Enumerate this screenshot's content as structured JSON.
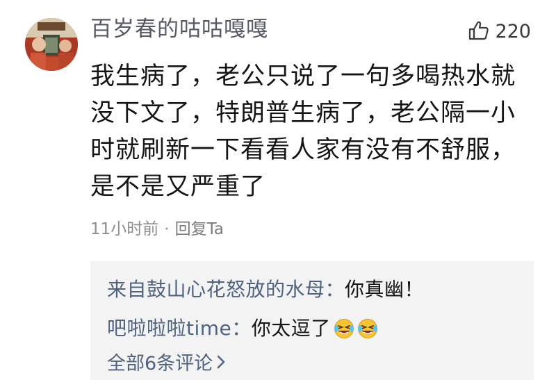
{
  "comment": {
    "username": "百岁春的咕咕嘎嘎",
    "like_count": "220",
    "body_lines": [
      "我生病了，老公只说了一句多喝热水就",
      "没下文了，特朗普生病了，老公隔一小",
      "时就刷新一下看看人家有没有不舒服，",
      "是不是又严重了"
    ],
    "time": "11小时前",
    "separator": "·",
    "reply_label": "回复Ta"
  },
  "replies": [
    {
      "name": "来自鼓山心花怒放的水母：",
      "text": "你真幽！",
      "emoji_count": 0
    },
    {
      "name": "吧啦啦啦time：",
      "text": "你太逗了",
      "emoji_count": 2
    }
  ],
  "all_replies_link": "全部6条评论",
  "icons": {
    "like": "thumbs-up-icon",
    "emoji": "laughing-crying-emoji-icon",
    "chevron": "chevron-right-icon"
  },
  "colors": {
    "username": "#555a66",
    "reply_name": "#4f6380",
    "meta": "#8e8e8e",
    "reply_bg": "#f3f3f3"
  }
}
